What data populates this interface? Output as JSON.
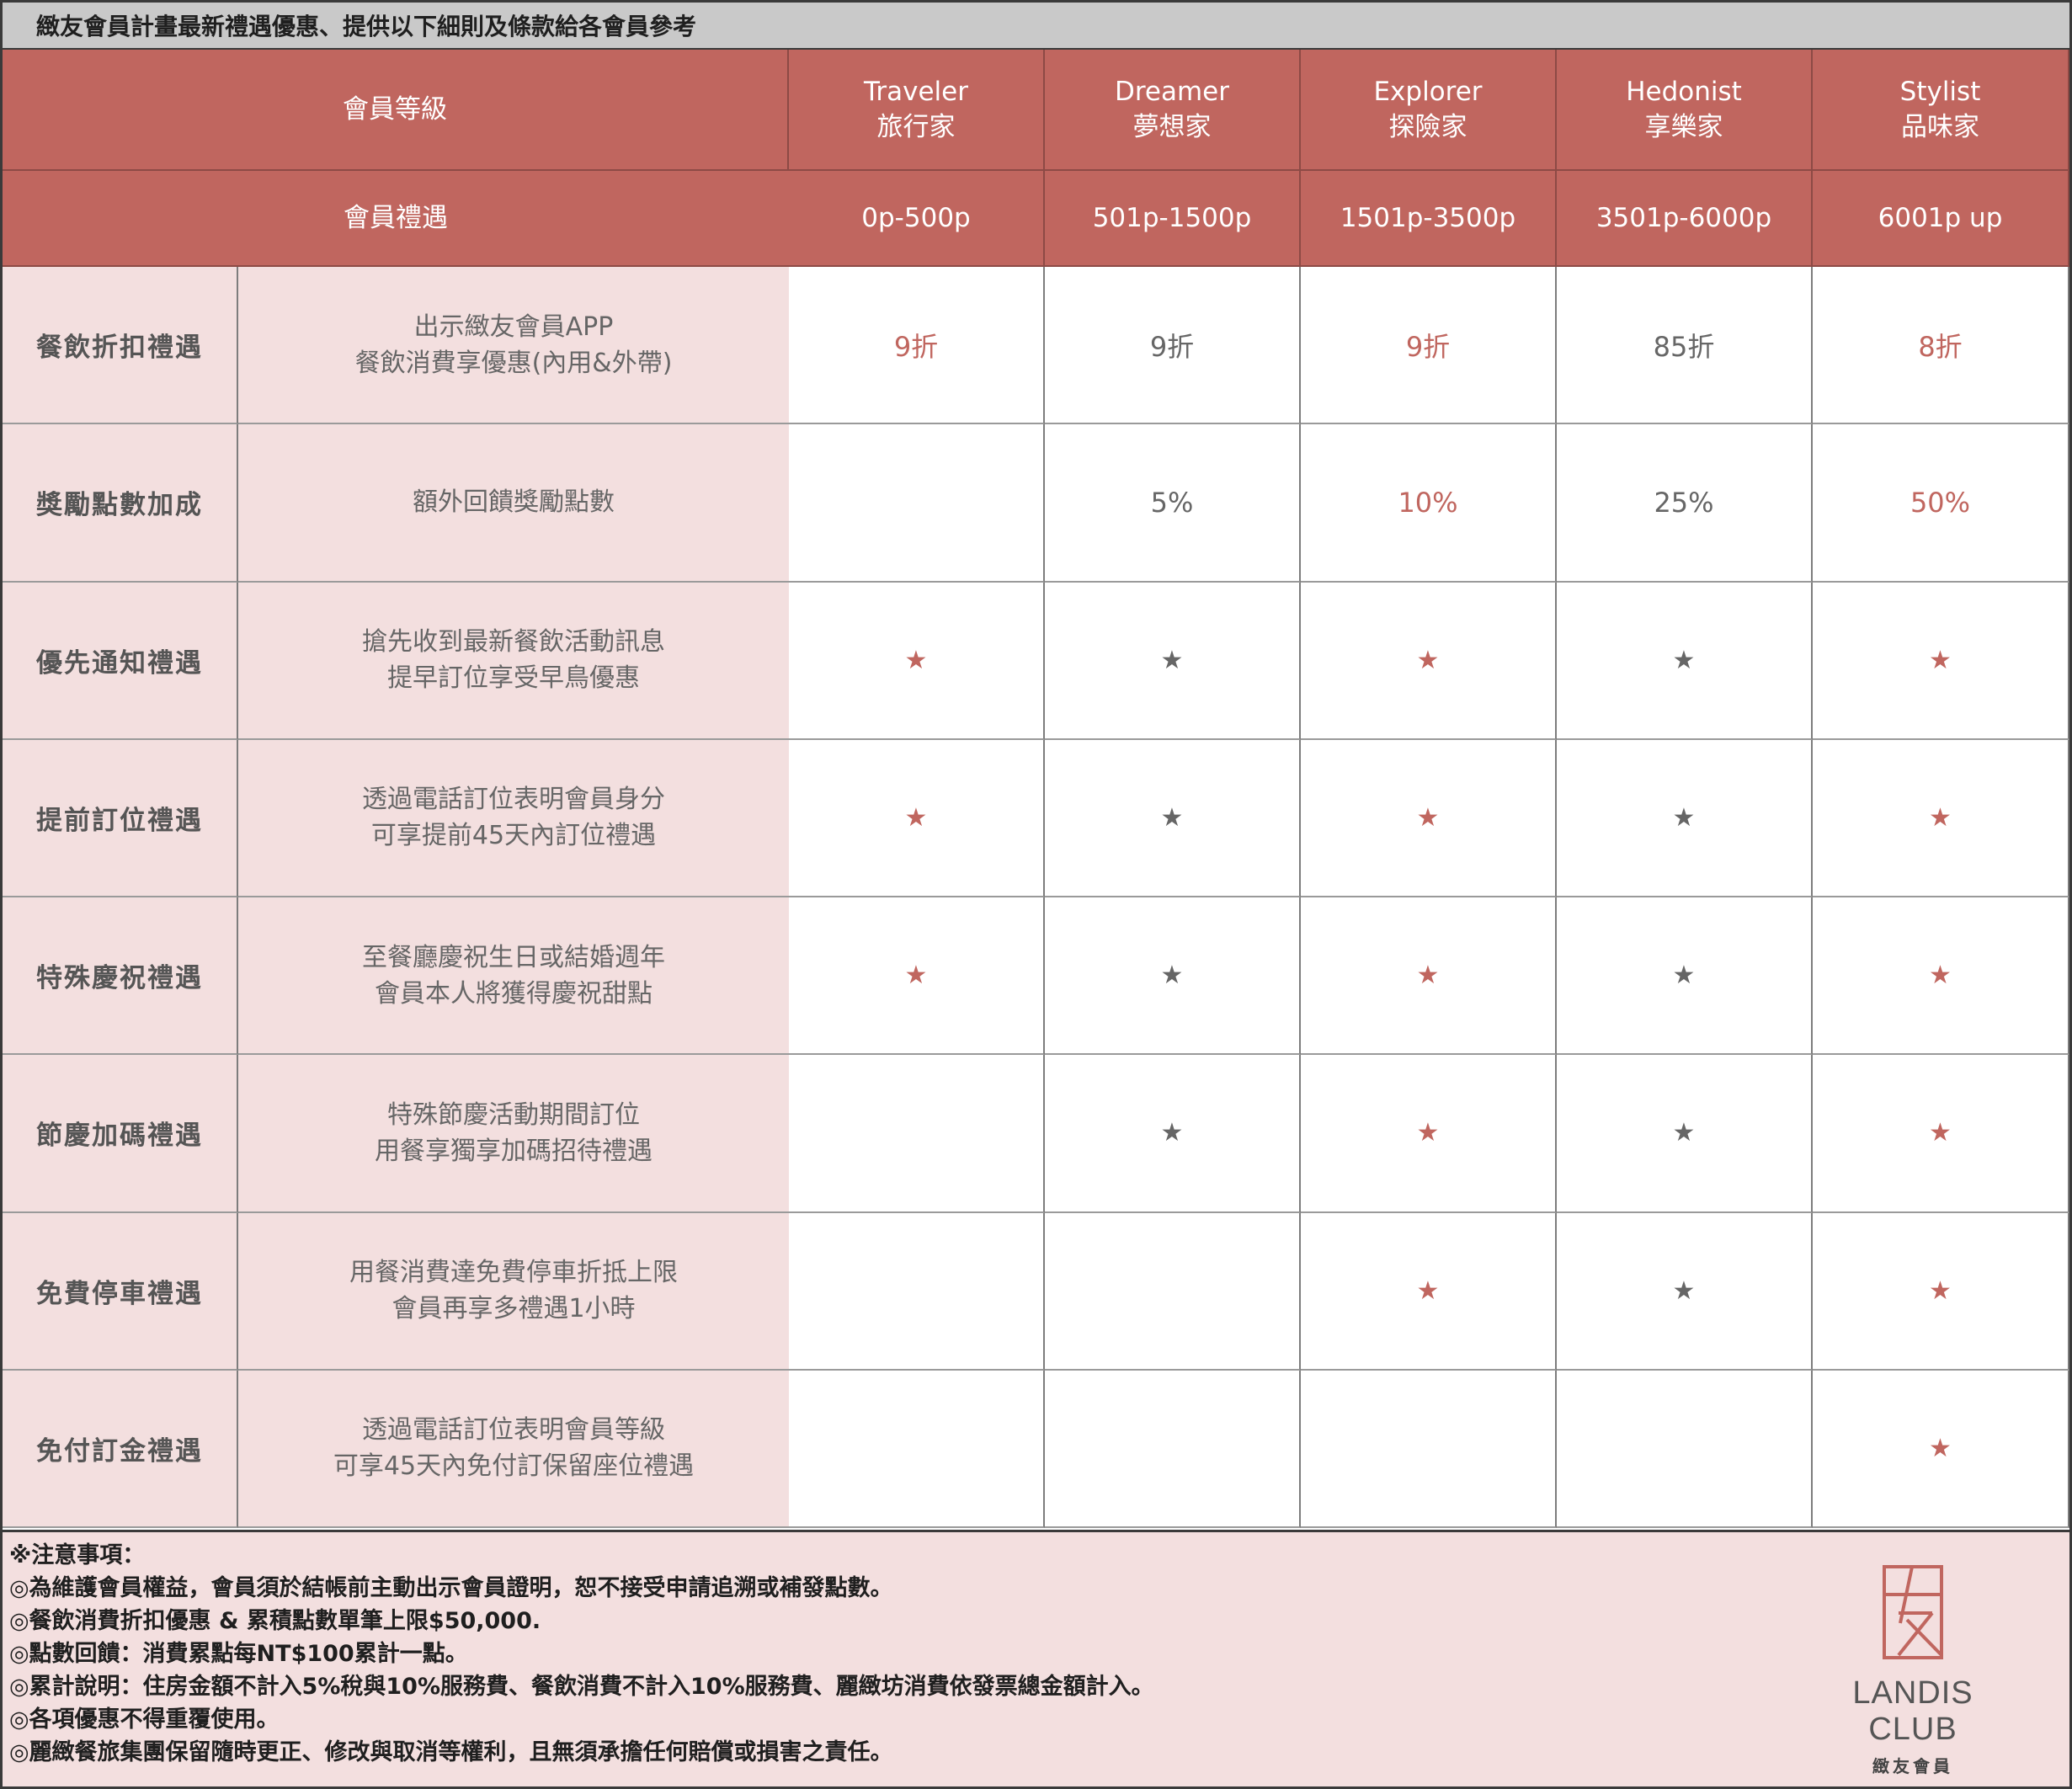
{
  "title": "緻友會員計畫最新禮遇優惠、提供以下細則及條款給各會員參考",
  "header": {
    "level_label": "會員等級",
    "benefit_label": "會員禮遇",
    "levels": [
      {
        "en": "Traveler",
        "zh": "旅行家",
        "points": "0p-500p"
      },
      {
        "en": "Dreamer",
        "zh": "夢想家",
        "points": "501p-1500p"
      },
      {
        "en": "Explorer",
        "zh": "探險家",
        "points": "1501p-3500p"
      },
      {
        "en": "Hedonist",
        "zh": "享樂家",
        "points": "3501p-6000p"
      },
      {
        "en": "Stylist",
        "zh": "品味家",
        "points": "6001p up"
      }
    ]
  },
  "colors": {
    "accent": "#c0665f",
    "benefit_bg": "#f3dfdf",
    "neutral_star": "#666666"
  },
  "rows": [
    {
      "name": "餐飲折扣禮遇",
      "desc": [
        "出示緻友會員APP",
        "餐飲消費享優惠(內用&外帶)"
      ],
      "values": [
        "9折",
        "9折",
        "9折",
        "85折",
        "8折"
      ]
    },
    {
      "name": "獎勵點數加成",
      "desc": [
        "額外回饋獎勵點數"
      ],
      "values": [
        "",
        "5%",
        "10%",
        "25%",
        "50%"
      ]
    },
    {
      "name": "優先通知禮遇",
      "desc": [
        "搶先收到最新餐飲活動訊息",
        "提早訂位享受早鳥優惠"
      ],
      "values": [
        "★",
        "★",
        "★",
        "★",
        "★"
      ]
    },
    {
      "name": "提前訂位禮遇",
      "desc": [
        "透過電話訂位表明會員身分",
        "可享提前45天內訂位禮遇"
      ],
      "values": [
        "★",
        "★",
        "★",
        "★",
        "★"
      ]
    },
    {
      "name": "特殊慶祝禮遇",
      "desc": [
        "至餐廳慶祝生日或結婚週年",
        "會員本人將獲得慶祝甜點"
      ],
      "values": [
        "★",
        "★",
        "★",
        "★",
        "★"
      ]
    },
    {
      "name": "節慶加碼禮遇",
      "desc": [
        "特殊節慶活動期間訂位",
        "用餐享獨享加碼招待禮遇"
      ],
      "values": [
        "",
        "★",
        "★",
        "★",
        "★"
      ]
    },
    {
      "name": "免費停車禮遇",
      "desc": [
        "用餐消費達免費停車折抵上限",
        "會員再享多禮遇1小時"
      ],
      "values": [
        "",
        "",
        "★",
        "★",
        "★"
      ]
    },
    {
      "name": "免付訂金禮遇",
      "desc": [
        "透過電話訂位表明會員等級",
        "可享45天內免付訂保留座位禮遇"
      ],
      "values": [
        "",
        "",
        "",
        "",
        "★"
      ]
    }
  ],
  "notes": {
    "heading": "※注意事項：",
    "items": [
      "◎為維護會員權益，會員須於結帳前主動出示會員證明，恕不接受申請追溯或補發點數。",
      "◎餐飲消費折扣優惠 & 累積點數單筆上限$50,000.",
      "◎點數回饋：消費累點每NT$100累計一點。",
      "◎累計說明：住房金額不計入5%稅與10%服務費、餐飲消費不計入10%服務費、麗緻坊消費依發票總金額計入。",
      "◎各項優惠不得重覆使用。",
      "◎麗緻餐旅集團保留隨時更正、修改與取消等權利，且無須承擔任何賠償或損害之責任。"
    ]
  },
  "logo": {
    "en": "LANDIS CLUB",
    "zh": "緻友會員"
  }
}
